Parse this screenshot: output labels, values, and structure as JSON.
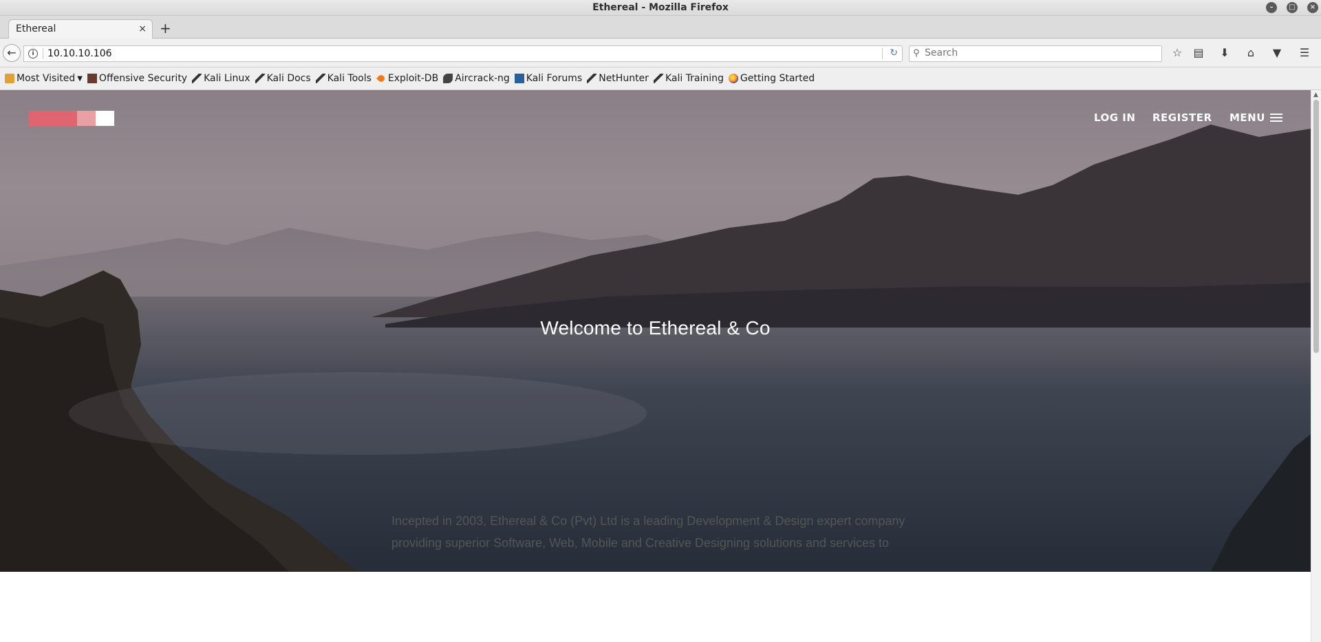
{
  "window": {
    "title": "Ethereal - Mozilla Firefox"
  },
  "tab": {
    "label": "Ethereal",
    "close": "×",
    "new_tab": "+"
  },
  "navbar": {
    "url": "10.10.10.106",
    "search_placeholder": "Search"
  },
  "bookmarks": [
    {
      "label": "Most Visited",
      "icon": "folder-icon"
    },
    {
      "label": "Offensive Security",
      "icon": "offsec-icon"
    },
    {
      "label": "Kali Linux",
      "icon": "kali-dragon-icon"
    },
    {
      "label": "Kali Docs",
      "icon": "kali-dragon-icon"
    },
    {
      "label": "Kali Tools",
      "icon": "kali-dragon-icon"
    },
    {
      "label": "Exploit-DB",
      "icon": "exploit-db-icon"
    },
    {
      "label": "Aircrack-ng",
      "icon": "aircrack-icon"
    },
    {
      "label": "Kali Forums",
      "icon": "kali-forums-icon"
    },
    {
      "label": "NetHunter",
      "icon": "kali-dragon-icon"
    },
    {
      "label": "Kali Training",
      "icon": "kali-dragon-icon"
    },
    {
      "label": "Getting Started",
      "icon": "firefox-icon"
    }
  ],
  "site": {
    "nav": {
      "login": "LOG IN",
      "register": "REGISTER",
      "menu": "MENU"
    },
    "hero_title": "Welcome to Ethereal & Co",
    "intro_line1": "Incepted in 2003, Ethereal & Co (Pvt) Ltd is a leading Development & Design expert company",
    "intro_line2": "providing superior Software, Web, Mobile and Creative Designing solutions and services to"
  },
  "colors": {
    "logo_primary": "#e06570",
    "logo_secondary": "#e8a0a5",
    "reload_accent": "#4a7fc1"
  }
}
